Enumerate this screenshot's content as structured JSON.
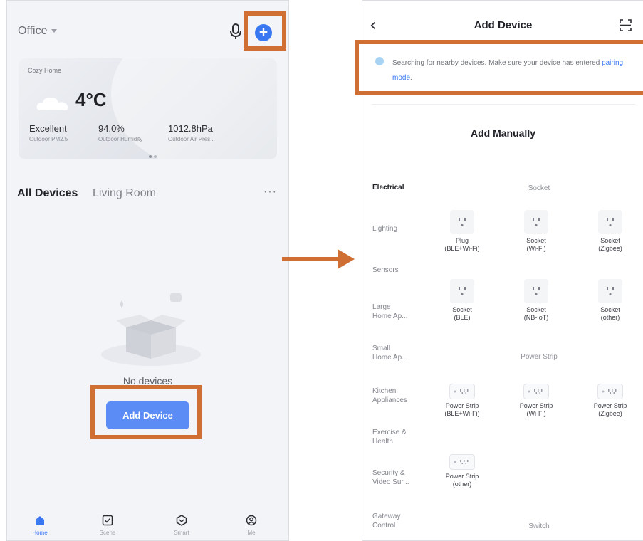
{
  "home_screen": {
    "home_name": "Office",
    "weather": {
      "home_label": "Cozy Home",
      "temperature": "4°C",
      "stats": [
        {
          "value": "Excellent",
          "label": "Outdoor PM2.5"
        },
        {
          "value": "94.0%",
          "label": "Outdoor Humidity"
        },
        {
          "value": "1012.8hPa",
          "label": "Outdoor Air Pres..."
        }
      ]
    },
    "tabs": {
      "all": "All Devices",
      "living": "Living Room",
      "more": "···"
    },
    "empty_text": "No devices",
    "add_device_button": "Add Device",
    "nav": [
      {
        "label": "Home",
        "icon": "home-icon"
      },
      {
        "label": "Scene",
        "icon": "scene-icon"
      },
      {
        "label": "Smart",
        "icon": "smart-icon"
      },
      {
        "label": "Me",
        "icon": "me-icon"
      }
    ]
  },
  "add_device_screen": {
    "title": "Add Device",
    "search_text": "Searching for nearby devices. Make sure your device has entered ",
    "pairing_link": "pairing mode",
    "search_text_end": ".",
    "add_manually": "Add Manually",
    "categories": [
      "Electrical",
      "Lighting",
      "Sensors",
      "Large\nHome Ap...",
      "Small\nHome Ap...",
      "Kitchen\nAppliances",
      "Exercise &\nHealth",
      "Security &\nVideo Sur...",
      "Gateway\nControl"
    ],
    "sections": {
      "socket": "Socket",
      "power_strip": "Power Strip",
      "switch": "Switch"
    },
    "socket_devices": [
      "Plug\n(BLE+Wi-Fi)",
      "Socket\n(Wi-Fi)",
      "Socket\n(Zigbee)",
      "Socket\n(BLE)",
      "Socket\n(NB-IoT)",
      "Socket\n(other)"
    ],
    "strip_devices": [
      "Power Strip\n(BLE+Wi-Fi)",
      "Power Strip\n(Wi-Fi)",
      "Power Strip\n(Zigbee)",
      "Power Strip\n(other)"
    ]
  },
  "colors": {
    "accent": "#3a78f2",
    "highlight": "#d06f33",
    "button": "#5b8cf5"
  }
}
